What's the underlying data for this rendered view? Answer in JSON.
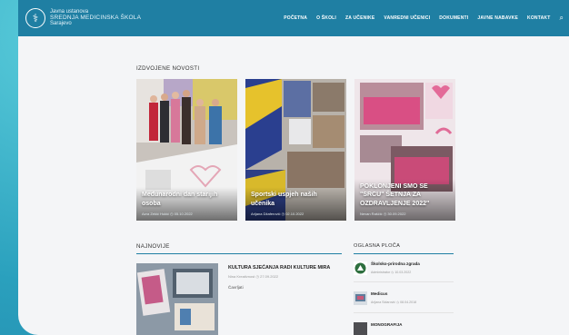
{
  "header": {
    "logo_line1": "Javna ustanova",
    "logo_line2": "SREDNJA MEDICINSKA ŠKOLA",
    "logo_line3": "Sarajevo",
    "nav": [
      "POČETNA",
      "O ŠKOLI",
      "ZA UČENIKE",
      "VANREDNI UČENICI",
      "DOKUMENTI",
      "JAVNE NABAVKE",
      "KONTAKT"
    ],
    "search_icon": "search-icon"
  },
  "featured": {
    "title": "IZDVOJENE NOVOSTI",
    "cards": [
      {
        "title": "Međunarodni dan starijih osoba",
        "author": "Azra Zekić Hukić",
        "date": "05.10.2022"
      },
      {
        "title": "Sportski uspjeh naših učenika",
        "author": "Arijana Džaferović",
        "date": "02.10.2022"
      },
      {
        "title": "POKLONJENI SMO SE \"SRCU\" ŠETNJA ZA OZDRAVLJENJE 2022\"",
        "author": "Nevan Raščić",
        "date": "30.09.2022"
      }
    ]
  },
  "latest": {
    "title": "NAJNOVIJE",
    "item_title": "KULTURA SJEĆANJA RADI KULTURE MIRA",
    "item_author": "Nina Kreativnost",
    "item_date": "27.09.2022",
    "item_category": "Čavrljati"
  },
  "board": {
    "title": "OGLASNA PLOČA",
    "items": [
      {
        "title": "Školsko-prirodna zgrada",
        "author": "Administrator",
        "date": "10.03.2022"
      },
      {
        "title": "Medicus",
        "author": "Arijana Sidarović",
        "date": "08.04.2018"
      },
      {
        "title": "MONOGRAFIJA",
        "author": "",
        "date": ""
      }
    ]
  },
  "colors": {
    "header": "#1f7fa3",
    "accent": "#1f7fa3",
    "bezel": "#2fa8c4"
  }
}
